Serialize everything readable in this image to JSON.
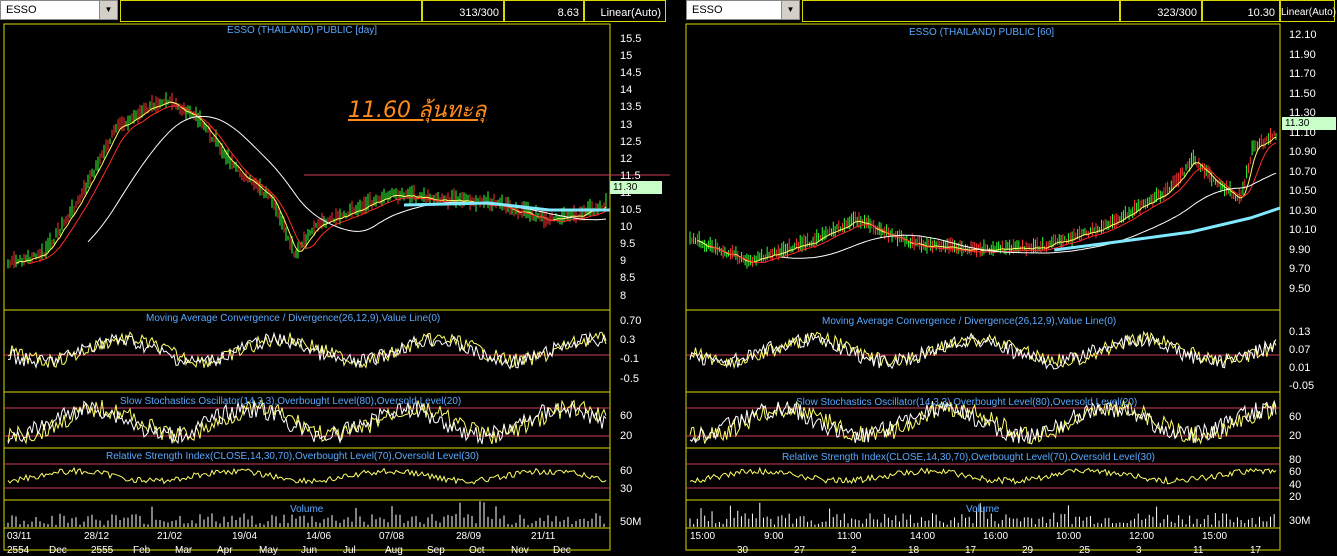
{
  "left": {
    "symbol": "ESSO",
    "count": "313/300",
    "last": "8.63",
    "scale": "Linear(Auto)",
    "chart_title": "ESSO (THAILAND) PUBLIC [day]",
    "price_label": "11.30",
    "annotation": "11.60 ลุ้นทะลุ",
    "price_ticks": [
      "15.5",
      "15",
      "14.5",
      "14",
      "13.5",
      "13",
      "12.5",
      "12",
      "11.5",
      "11",
      "10.5",
      "10",
      "9.5",
      "9",
      "8.5",
      "8"
    ],
    "macd_title": "Moving Average Convergence / Divergence(26,12,9),Value Line(0)",
    "macd_ticks": [
      "0.70",
      "0.3",
      "-0.1",
      "-0.5"
    ],
    "stoch_title": "Slow Stochastics Oscillator(14,3,3),Overbought Level(80),Oversold Level(20)",
    "stoch_ticks": [
      "60",
      "20"
    ],
    "rsi_title": "Relative Strength Index(CLOSE,14,30,70),Overbought Level(70),Oversold Level(30)",
    "rsi_ticks": [
      "60",
      "30"
    ],
    "vol_title": "Volume",
    "vol_ticks": [
      "50M"
    ],
    "x_top": [
      "03/11",
      "28/12",
      "21/02",
      "19/04",
      "14/06",
      "07/08",
      "28/09",
      "21/11"
    ],
    "x_bottom": [
      "2554",
      "Dec",
      "2555",
      "Feb",
      "Mar",
      "Apr",
      "May",
      "Jun",
      "Jul",
      "Aug",
      "Sep",
      "Oct",
      "Nov",
      "Dec"
    ]
  },
  "right": {
    "symbol": "ESSO",
    "count": "323/300",
    "last": "10.30",
    "scale": "Linear(Auto)",
    "chart_title": "ESSO (THAILAND) PUBLIC [60]",
    "price_label": "11.30",
    "price_ticks": [
      "12.10",
      "11.90",
      "11.70",
      "11.50",
      "11.30",
      "11.10",
      "10.90",
      "10.70",
      "10.50",
      "10.30",
      "10.10",
      "9.90",
      "9.70",
      "9.50"
    ],
    "macd_title": "Moving Average Convergence / Divergence(26,12,9),Value Line(0)",
    "macd_ticks": [
      "0.13",
      "0.07",
      "0.01",
      "-0.05"
    ],
    "stoch_title": "Slow Stochastics Oscillator(14,3,3),Overbought Level(80),Oversold Level(20)",
    "stoch_ticks": [
      "60",
      "20"
    ],
    "rsi_title": "Relative Strength Index(CLOSE,14,30,70),Overbought Level(70),Oversold Level(30)",
    "rsi_ticks": [
      "80",
      "60",
      "40",
      "20"
    ],
    "vol_title": "Volume",
    "vol_ticks": [
      "30M"
    ],
    "x_top": [
      "15:00",
      "9:00",
      "11:00",
      "14:00",
      "16:00",
      "10:00",
      "12:00",
      "15:00"
    ],
    "x_bottom": [
      "30",
      "27",
      "2",
      "18",
      "17",
      "29",
      "25",
      "3",
      "11",
      "17"
    ]
  },
  "colors": {
    "background": "#000000",
    "frame": "#d8d800",
    "title": "#5aa8ff",
    "level_line": "#d03c5a",
    "candle_up": "#33ff33",
    "candle_down": "#ff3333",
    "ma_short": "#ffff66",
    "ma_mid": "#ff2a2a",
    "ma_long": "#ffffff",
    "ma_cyan": "#80e8ff",
    "annotation": "#ff8c1a"
  }
}
